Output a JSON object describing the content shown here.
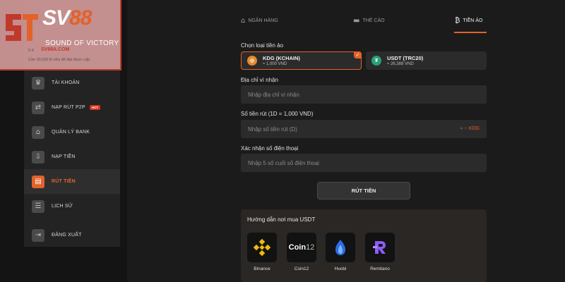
{
  "brand": {
    "name_main": "SV",
    "name_accent": "88",
    "slogan": "SOUND OF VICTORY",
    "site": "SV88A.COM",
    "balance_prefix": "0 đ",
    "note": "Cần 30,000 Đ nữa để đạt được cấp"
  },
  "sidebar": {
    "items": [
      {
        "label": "TÀI KHOẢN",
        "icon": "crown-icon",
        "glyph": "♛",
        "active": false
      },
      {
        "label": "NẠP RÚT P2P",
        "icon": "p2p-icon",
        "glyph": "⇄",
        "active": false,
        "badge": "HOT"
      },
      {
        "label": "QUẢN LÝ BANK",
        "icon": "bank-icon",
        "glyph": "⌂",
        "active": false
      },
      {
        "label": "NẠP TIỀN",
        "icon": "deposit-icon",
        "glyph": "⇩",
        "active": false
      },
      {
        "label": "RÚT TIỀN",
        "icon": "withdraw-icon",
        "glyph": "▤",
        "active": true
      },
      {
        "label": "LỊCH SỬ",
        "icon": "history-icon",
        "glyph": "☰",
        "active": false
      },
      {
        "label": "ĐĂNG XUẤT",
        "icon": "logout-icon",
        "glyph": "⇥",
        "active": false
      }
    ]
  },
  "tabs": [
    {
      "label": "NGÂN HÀNG",
      "icon": "bank-icon",
      "glyph": "⌂",
      "active": false
    },
    {
      "label": "THẺ CÀO",
      "icon": "card-icon",
      "glyph": "▬",
      "active": false
    },
    {
      "label": "TIỀN ẢO",
      "icon": "crypto-icon",
      "glyph": "₿",
      "active": true
    }
  ],
  "form": {
    "crypto_label": "Chọn loại tiền ảo",
    "coins": [
      {
        "name": "KDG (KCHAIN)",
        "rate": "≈ 1,000 VND",
        "icon": "kdg-coin-icon",
        "color": "#e28a2a",
        "symbol": "◎",
        "selected": true
      },
      {
        "name": "USDT (TRC20)",
        "rate": "≈ 26,388 VND",
        "icon": "usdt-coin-icon",
        "color": "#26a17b",
        "symbol": "₮",
        "selected": false
      }
    ],
    "address_label": "Địa chỉ ví nhận",
    "address_placeholder": "Nhập địa chỉ ví nhận",
    "amount_label": "Số tiền rút (1D = 1,000 VND)",
    "amount_placeholder": "Nhập số tiền rút (D)",
    "amount_suffix": "≈ -- KDG",
    "phone_label": "Xác nhận số điện thoại",
    "phone_placeholder": "Nhập 5 số cuối số điện thoại",
    "submit_label": "RÚT TIỀN"
  },
  "guide": {
    "title": "Hướng dẫn nơi mua USDT",
    "exchanges": [
      {
        "name": "Binance",
        "icon": "binance-icon",
        "color": "#f0b90b"
      },
      {
        "name": "Coin12",
        "icon": "coin12-icon",
        "color": "#ffffff",
        "logo_text": "Coin",
        "logo_num": "12"
      },
      {
        "name": "Huobi",
        "icon": "huobi-icon",
        "color": "#2a6ee6"
      },
      {
        "name": "Remitano",
        "icon": "remitano-icon",
        "color": "#8b5cf6"
      }
    ]
  },
  "colors": {
    "accent": "#e2622a",
    "active_tab": "#f2f2f2"
  }
}
